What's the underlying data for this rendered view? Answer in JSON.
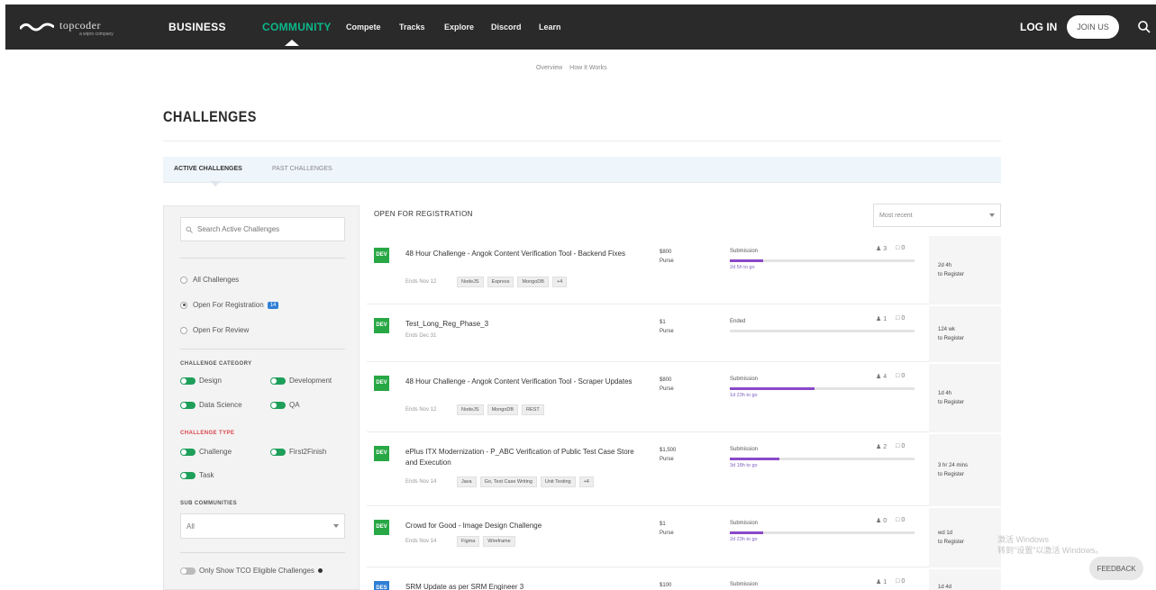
{
  "nav": {
    "logo_text": "topcoder",
    "logo_sub": "a wipro company",
    "business": "BUSINESS",
    "community": "COMMUNITY",
    "sub_items": [
      "Compete",
      "Tracks",
      "Explore",
      "Discord",
      "Learn"
    ],
    "login": "LOG IN",
    "join": "JOIN US"
  },
  "sublinks": [
    "Overview",
    "How It Works"
  ],
  "page_title": "CHALLENGES",
  "tabs": {
    "active": "ACTIVE CHALLENGES",
    "past": "PAST CHALLENGES"
  },
  "sidebar": {
    "search_placeholder": "Search Active Challenges",
    "radios": [
      {
        "label": "All Challenges",
        "checked": false
      },
      {
        "label": "Open For Registration",
        "checked": true,
        "badge": "14"
      },
      {
        "label": "Open For Review",
        "checked": false
      }
    ],
    "category_heading": "CHALLENGE CATEGORY",
    "categories": [
      "Design",
      "Development",
      "Data Science",
      "QA"
    ],
    "type_heading": "CHALLENGE TYPE",
    "types": [
      "Challenge",
      "First2Finish",
      "Task"
    ],
    "sub_heading": "SUB COMMUNITIES",
    "sub_value": "All",
    "bottom_toggle": "Only Show TCO Eligible Challenges"
  },
  "list": {
    "heading": "OPEN FOR REGISTRATION",
    "sort_placeholder": "Most recent",
    "rows": [
      {
        "icon": "DEV",
        "track": "green",
        "title": "48 Hour Challenge - Angok Content Verification Tool - Backend Fixes",
        "sub": "Ends Nov 12",
        "tags": [
          "NodeJS",
          "Express",
          "MongoDB",
          "+4"
        ],
        "prize": "$800",
        "prize_label": "Purse",
        "phase": "Submission",
        "progress": 0.18,
        "time": "2d 5h to go",
        "stat1": "3",
        "stat2": "0",
        "reg_time": "2d 4h",
        "reg_label": "to Register"
      },
      {
        "icon": "DEV",
        "track": "green",
        "title": "Test_Long_Reg_Phase_3",
        "sub": "Ends Dec 31",
        "tags": [],
        "prize": "$1",
        "prize_label": "Purse",
        "phase": "Ended",
        "progress": 0,
        "time": "",
        "stat1": "1",
        "stat2": "0",
        "reg_time": "124 wk",
        "reg_label": "to Register"
      },
      {
        "icon": "DEV",
        "track": "green",
        "title": "48 Hour Challenge - Angok Content Verification Tool - Scraper Updates",
        "sub": "Ends Nov 12",
        "tags": [
          "NodeJS",
          "MongoDB",
          "REST"
        ],
        "prize": "$800",
        "prize_label": "Purse",
        "phase": "Submission",
        "progress": 0.46,
        "time": "1d 23h to go",
        "stat1": "4",
        "stat2": "0",
        "reg_time": "1d 4h",
        "reg_label": "to Register"
      },
      {
        "icon": "DEV",
        "track": "green",
        "title": "ePlus ITX Modernization - P_ABC Verification of Public Test Case Store and Execution",
        "sub": "Ends Nov 14",
        "tags": [
          "Java",
          "Go, Test Case Writing",
          "Unit Testing",
          "+4"
        ],
        "prize": "$1,500",
        "prize_label": "Purse",
        "phase": "Submission",
        "progress": 0.27,
        "time": "3d 18h to go",
        "stat1": "2",
        "stat2": "0",
        "reg_time": "3 hr 24 mins",
        "reg_label": "to Register"
      },
      {
        "icon": "DEV",
        "track": "green",
        "title": "Crowd for Good - Image Design Challenge",
        "sub": "Ends Nov 14",
        "tags": [
          "Figma",
          "Wireframe"
        ],
        "prize": "$1",
        "prize_label": "Purse",
        "phase": "Submission",
        "progress": 0.18,
        "time": "2d 23h to go",
        "stat1": "0",
        "stat2": "0",
        "reg_time": "wd 1d",
        "reg_label": "to Register"
      },
      {
        "icon": "DES",
        "track": "blue",
        "title": "SRM Update as per SRM Engineer 3",
        "sub": "",
        "tags": [],
        "prize": "$100",
        "prize_label": "",
        "phase": "Submission",
        "progress": 0,
        "time": "",
        "stat1": "1",
        "stat2": "0",
        "reg_time": "1d 4d",
        "reg_label": ""
      }
    ]
  },
  "watermark": [
    "激活 Windows",
    "转到\"设置\"以激活 Windows。"
  ],
  "chat": "FEEDBACK",
  "colors": {
    "nav_bg": "#2a2a2a",
    "community": "#0ab88a",
    "toggle_on": "#1e9f5a",
    "phase": "#8a48c9",
    "dev_track": "#28a745",
    "design_track": "#2f7fd5"
  }
}
